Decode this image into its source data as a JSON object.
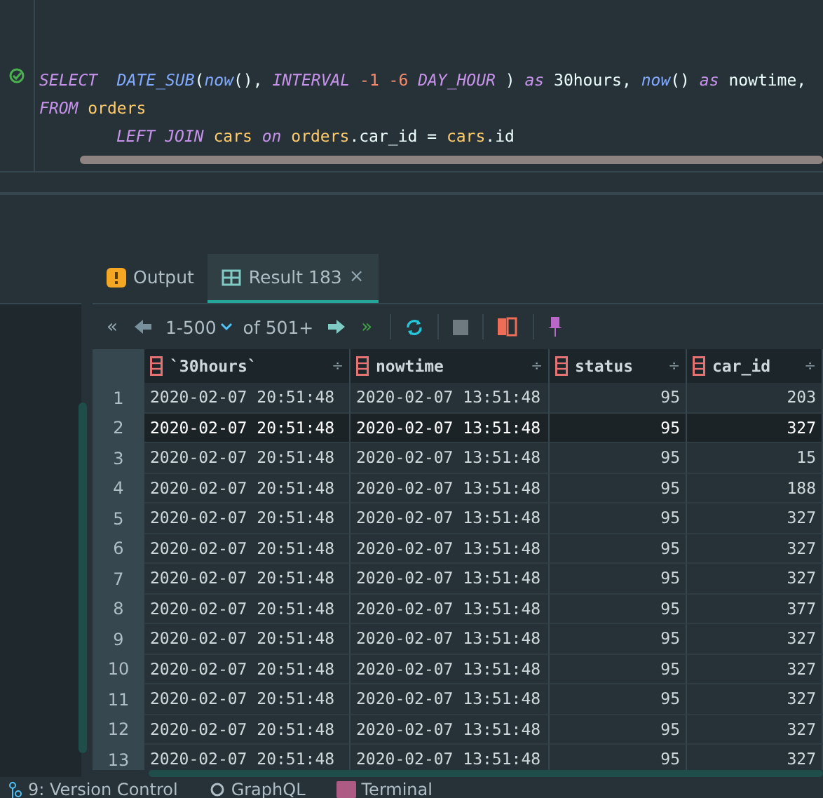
{
  "editor": {
    "lines": [
      {
        "tokens": [
          {
            "kind": "keyword",
            "text": "SELECT  "
          },
          {
            "kind": "func",
            "text": "DATE_SUB"
          },
          {
            "kind": "plain",
            "text": "("
          },
          {
            "kind": "func",
            "text": "now"
          },
          {
            "kind": "plain",
            "text": "(), "
          },
          {
            "kind": "keyword",
            "text": "INTERVAL "
          },
          {
            "kind": "number",
            "text": "-1 -6 "
          },
          {
            "kind": "keyword",
            "text": "DAY_HOUR"
          },
          {
            "kind": "plain",
            "text": " ) "
          },
          {
            "kind": "keyword",
            "text": "as"
          },
          {
            "kind": "plain",
            "text": " 30hours, "
          },
          {
            "kind": "func",
            "text": "now"
          },
          {
            "kind": "plain",
            "text": "() "
          },
          {
            "kind": "keyword",
            "text": "as"
          },
          {
            "kind": "plain",
            "text": " nowtime,"
          }
        ]
      },
      {
        "tokens": [
          {
            "kind": "keyword",
            "text": "FROM "
          },
          {
            "kind": "ident",
            "text": "orders"
          }
        ],
        "children": [
          {
            "tokens": [
              {
                "kind": "keyword",
                "text": "LEFT JOIN "
              },
              {
                "kind": "ident",
                "text": "cars "
              },
              {
                "kind": "keyword",
                "text": "on "
              },
              {
                "kind": "ident",
                "text": "orders"
              },
              {
                "kind": "plain",
                "text": ".car_id = "
              },
              {
                "kind": "ident",
                "text": "cars"
              },
              {
                "kind": "plain",
                "text": ".id"
              }
            ]
          }
        ]
      }
    ]
  },
  "tabs": [
    {
      "label": "Output",
      "kind": "output",
      "selected": false,
      "closable": false
    },
    {
      "label": "Result 183",
      "kind": "table",
      "selected": true,
      "closable": true
    }
  ],
  "tab_close": "×",
  "toolbar": {
    "first": "«",
    "range": "1-500",
    "of": "of 501+",
    "last": "»"
  },
  "table": {
    "columns": [
      "`30hours`",
      "nowtime",
      "status",
      "car_id"
    ],
    "sort_mark": "÷",
    "rows": [
      {
        "n": "1",
        "selected": false,
        "cells": [
          "2020-02-07 20:51:48",
          "2020-02-07 13:51:48",
          "95",
          "203"
        ]
      },
      {
        "n": "2",
        "selected": true,
        "cells": [
          "2020-02-07 20:51:48",
          "2020-02-07 13:51:48",
          "95",
          "327"
        ]
      },
      {
        "n": "3",
        "selected": false,
        "cells": [
          "2020-02-07 20:51:48",
          "2020-02-07 13:51:48",
          "95",
          "15"
        ]
      },
      {
        "n": "4",
        "selected": false,
        "cells": [
          "2020-02-07 20:51:48",
          "2020-02-07 13:51:48",
          "95",
          "188"
        ]
      },
      {
        "n": "5",
        "selected": false,
        "cells": [
          "2020-02-07 20:51:48",
          "2020-02-07 13:51:48",
          "95",
          "327"
        ]
      },
      {
        "n": "6",
        "selected": false,
        "cells": [
          "2020-02-07 20:51:48",
          "2020-02-07 13:51:48",
          "95",
          "327"
        ]
      },
      {
        "n": "7",
        "selected": false,
        "cells": [
          "2020-02-07 20:51:48",
          "2020-02-07 13:51:48",
          "95",
          "327"
        ]
      },
      {
        "n": "8",
        "selected": false,
        "cells": [
          "2020-02-07 20:51:48",
          "2020-02-07 13:51:48",
          "95",
          "377"
        ]
      },
      {
        "n": "9",
        "selected": false,
        "cells": [
          "2020-02-07 20:51:48",
          "2020-02-07 13:51:48",
          "95",
          "327"
        ]
      },
      {
        "n": "10",
        "selected": false,
        "cells": [
          "2020-02-07 20:51:48",
          "2020-02-07 13:51:48",
          "95",
          "327"
        ]
      },
      {
        "n": "11",
        "selected": false,
        "cells": [
          "2020-02-07 20:51:48",
          "2020-02-07 13:51:48",
          "95",
          "327"
        ]
      },
      {
        "n": "12",
        "selected": false,
        "cells": [
          "2020-02-07 20:51:48",
          "2020-02-07 13:51:48",
          "95",
          "327"
        ]
      },
      {
        "n": "13",
        "selected": false,
        "cells": [
          "2020-02-07 20:51:48",
          "2020-02-07 13:51:48",
          "95",
          "327"
        ]
      }
    ]
  },
  "status_bar": [
    {
      "label": "9: Version Control",
      "kind": "vcs"
    },
    {
      "label": "GraphQL",
      "kind": "graphql"
    },
    {
      "label": "Terminal",
      "kind": "terminal"
    }
  ]
}
